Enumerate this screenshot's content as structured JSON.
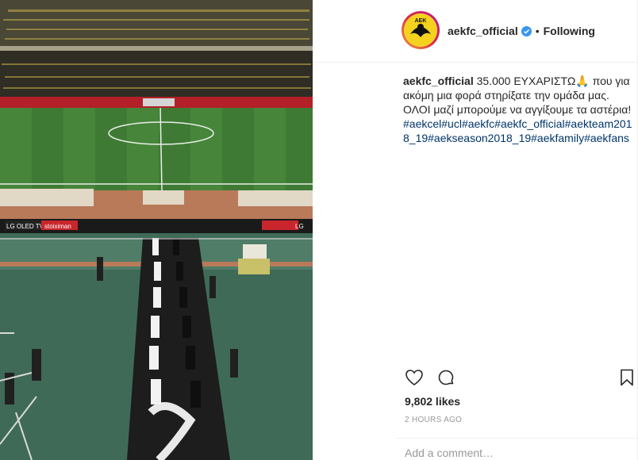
{
  "header": {
    "username": "aekfc_official",
    "separator": "•",
    "follow_state": "Following",
    "avatar_text": "AEK"
  },
  "caption": {
    "username": "aekfc_official",
    "line1": "35.000 ΕΥΧΑΡΙΣΤΩ🙏 που για ακόμη μια φορά στηρίξατε την ομάδα μας.",
    "line2": "ΟΛΟΙ μαζί μπορούμε να αγγίξουμε τα αστέρια!",
    "hashtags": "#aekcel#ucl#aekfc#aekfc_official#aekteam2018_19#aekseason2018_19#aekfamily#aekfans"
  },
  "stats": {
    "likes": "9,802 likes",
    "time": "2 HOURS AGO"
  },
  "comment": {
    "placeholder": "Add a comment…"
  },
  "photo": {
    "board_text_1": "LG OLED TV",
    "board_text_2": "stoiximan",
    "board_text_3": "LG"
  },
  "icons": {
    "like": "heart-icon",
    "comment": "comment-bubble-icon",
    "save": "bookmark-icon",
    "verified": "verified-badge-icon"
  },
  "colors": {
    "link": "#003569",
    "verified": "#3897f0",
    "muted": "#999999"
  }
}
